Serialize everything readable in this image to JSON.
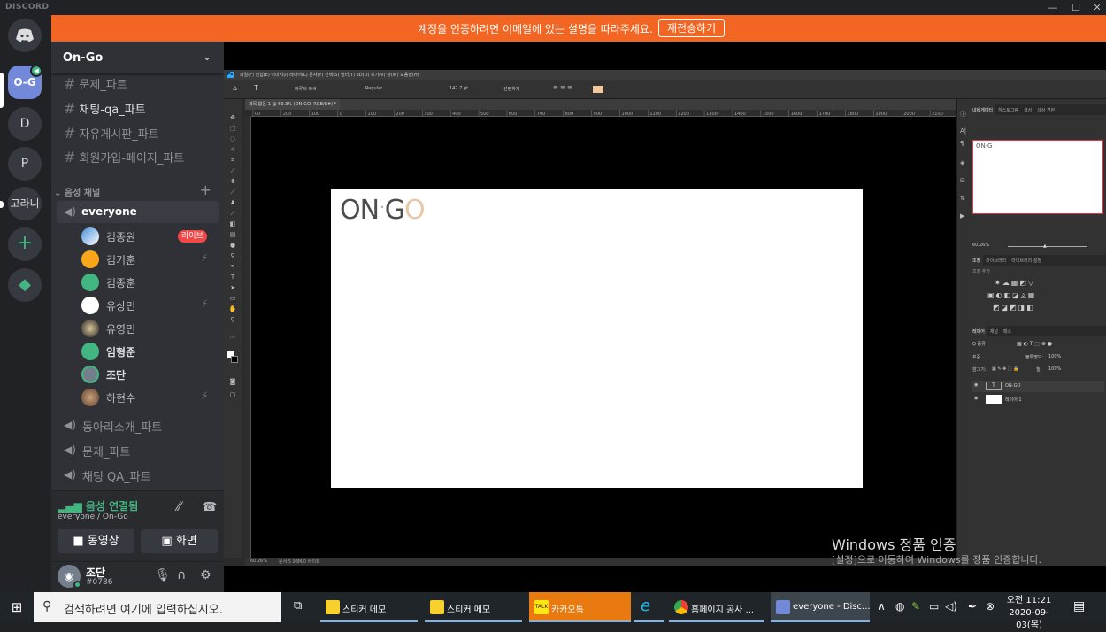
{
  "app": {
    "brand": "DISCORD",
    "window_controls": [
      "—",
      "☐",
      "✕"
    ]
  },
  "servers": [
    {
      "label": "",
      "icon": "discord-logo"
    },
    {
      "label": "O-G",
      "selected": true
    },
    {
      "label": "D"
    },
    {
      "label": "P"
    },
    {
      "label": "고라니"
    },
    {
      "label": "+",
      "icon": "add-server"
    },
    {
      "label": "",
      "icon": "explore-compass"
    }
  ],
  "banner": {
    "message": "계정을 인증하려면 이메일에 있는 설명을 따라주세요.",
    "button": "재전송하기"
  },
  "guild": {
    "name": "On-Go"
  },
  "text_channels": [
    "문제_파트",
    "채팅-qa_파트",
    "자유게시판_파트",
    "회원가입-페이지_파트"
  ],
  "voice_category": "음성 채널",
  "voice_channels": {
    "active": "everyone",
    "members": [
      {
        "name": "김종원",
        "badge": "라이브"
      },
      {
        "name": "김기훈",
        "muted": true
      },
      {
        "name": "김종훈"
      },
      {
        "name": "유상민",
        "muted": true
      },
      {
        "name": "유영민"
      },
      {
        "name": "임형준"
      },
      {
        "name": "조단"
      },
      {
        "name": "하현수",
        "muted": true
      }
    ],
    "others": [
      "동아리소개_파트",
      "문제_파트",
      "채팅 QA_파트"
    ]
  },
  "voice_connection": {
    "title": "음성 연결됨",
    "subtitle": "everyone / On-Go",
    "video_button": "동영상",
    "screen_button": "화면"
  },
  "user": {
    "name": "조단",
    "tag": "#0786"
  },
  "photoshop": {
    "menu": "파일(F)  편집(E)  이미지(I)  레이어(L)  문자(Y)  선택(S)  필터(T)  3D(D)  보기(V)  창(W)  도움말(H)",
    "font_family": "마루터 라써",
    "font_style": "Regular",
    "font_size": "142.7 pt",
    "antialias": "선명하게",
    "doc_tab": "제목 없음-1 @ 60.3% (ON-GO, RGB/8#) *",
    "ruler_ticks": [
      "00",
      "200",
      "100",
      "0",
      "100",
      "200",
      "300",
      "400",
      "500",
      "600",
      "700",
      "800",
      "900",
      "1000",
      "1100",
      "1200",
      "1300",
      "1400",
      "1500",
      "1600",
      "1700",
      "1800",
      "1900",
      "2000",
      "2100"
    ],
    "zoom_status": "60.26%",
    "doc_status": "문서:5.93M/0 바이트",
    "panel_tabs_top": [
      "내비게이터",
      "히스토그램",
      "색상",
      "색상 견본"
    ],
    "nav_logo": "ON·G",
    "nav_zoom": "60.26%",
    "adjust_tabs": [
      "조정",
      "라이브러리",
      "라이브러리 설정"
    ],
    "adjust_label": "조정 추가",
    "layers_tabs": [
      "레이어",
      "채널",
      "패스"
    ],
    "layers_kind": "Q 종류",
    "blend": "표준",
    "opacity_label": "불투명도:",
    "opacity": "100%",
    "lock_label": "잠그기:",
    "fill_label": "칠:",
    "fill": "100%",
    "layers": [
      {
        "name": "ON-GO",
        "type": "text"
      },
      {
        "name": "레이어 1",
        "type": "pixel"
      }
    ]
  },
  "artboard_logo": {
    "left": "ON",
    "dot": "·",
    "g": "G",
    "o": "O"
  },
  "windows_activation": {
    "title": "Windows 정품 인증",
    "subtitle": "[설정]으로 이동하여 Windows를 정품 인증합니다."
  },
  "taskbar": {
    "search_placeholder": "검색하려면 여기에 입력하십시오.",
    "apps": [
      {
        "label": "스티커 메모"
      },
      {
        "label": "스티커 메모"
      },
      {
        "label": "카카오톡"
      },
      {
        "label": ""
      },
      {
        "label": "홈페이지 공사 ..."
      },
      {
        "label": "everyone - Disc..."
      }
    ],
    "time": "오전 11:21",
    "date": "2020-09-03(목)"
  },
  "colors": {
    "banner": "#f26522",
    "accent": "#7289da",
    "online": "#43b581",
    "live": "#f04747"
  }
}
